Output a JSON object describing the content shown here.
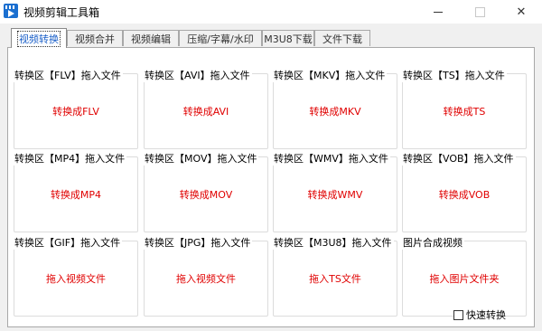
{
  "window": {
    "title": "视频剪辑工具箱",
    "close_glyph": "✕"
  },
  "tabs": [
    {
      "label": "视频转换",
      "active": true
    },
    {
      "label": "视频合并",
      "active": false
    },
    {
      "label": "视频编辑",
      "active": false
    },
    {
      "label": "压缩/字幕/水印",
      "active": false
    },
    {
      "label": "M3U8下载",
      "active": false
    },
    {
      "label": "文件下载",
      "active": false
    }
  ],
  "groups": [
    {
      "title": "转换区【FLV】拖入文件",
      "action": "转换成FLV"
    },
    {
      "title": "转换区【AVI】拖入文件",
      "action": "转换成AVI"
    },
    {
      "title": "转换区【MKV】拖入文件",
      "action": "转换成MKV"
    },
    {
      "title": "转换区【TS】拖入文件",
      "action": "转换成TS"
    },
    {
      "title": "转换区【MP4】拖入文件",
      "action": "转换成MP4"
    },
    {
      "title": "转换区【MOV】拖入文件",
      "action": "转换成MOV"
    },
    {
      "title": "转换区【WMV】拖入文件",
      "action": "转换成WMV"
    },
    {
      "title": "转换区【VOB】拖入文件",
      "action": "转换成VOB"
    },
    {
      "title": "转换区【GIF】拖入文件",
      "action": "拖入视频文件"
    },
    {
      "title": "转换区【JPG】拖入文件",
      "action": "拖入视频文件"
    },
    {
      "title": "转换区【M3U8】拖入文件",
      "action": "拖入TS文件"
    },
    {
      "title": "图片合成视频",
      "action": "拖入图片文件夹"
    }
  ],
  "fast_convert": {
    "label": "快速转换",
    "checked": false
  },
  "colors": {
    "accent_text": "#e00000",
    "active_tab": "#1a5fc8"
  }
}
